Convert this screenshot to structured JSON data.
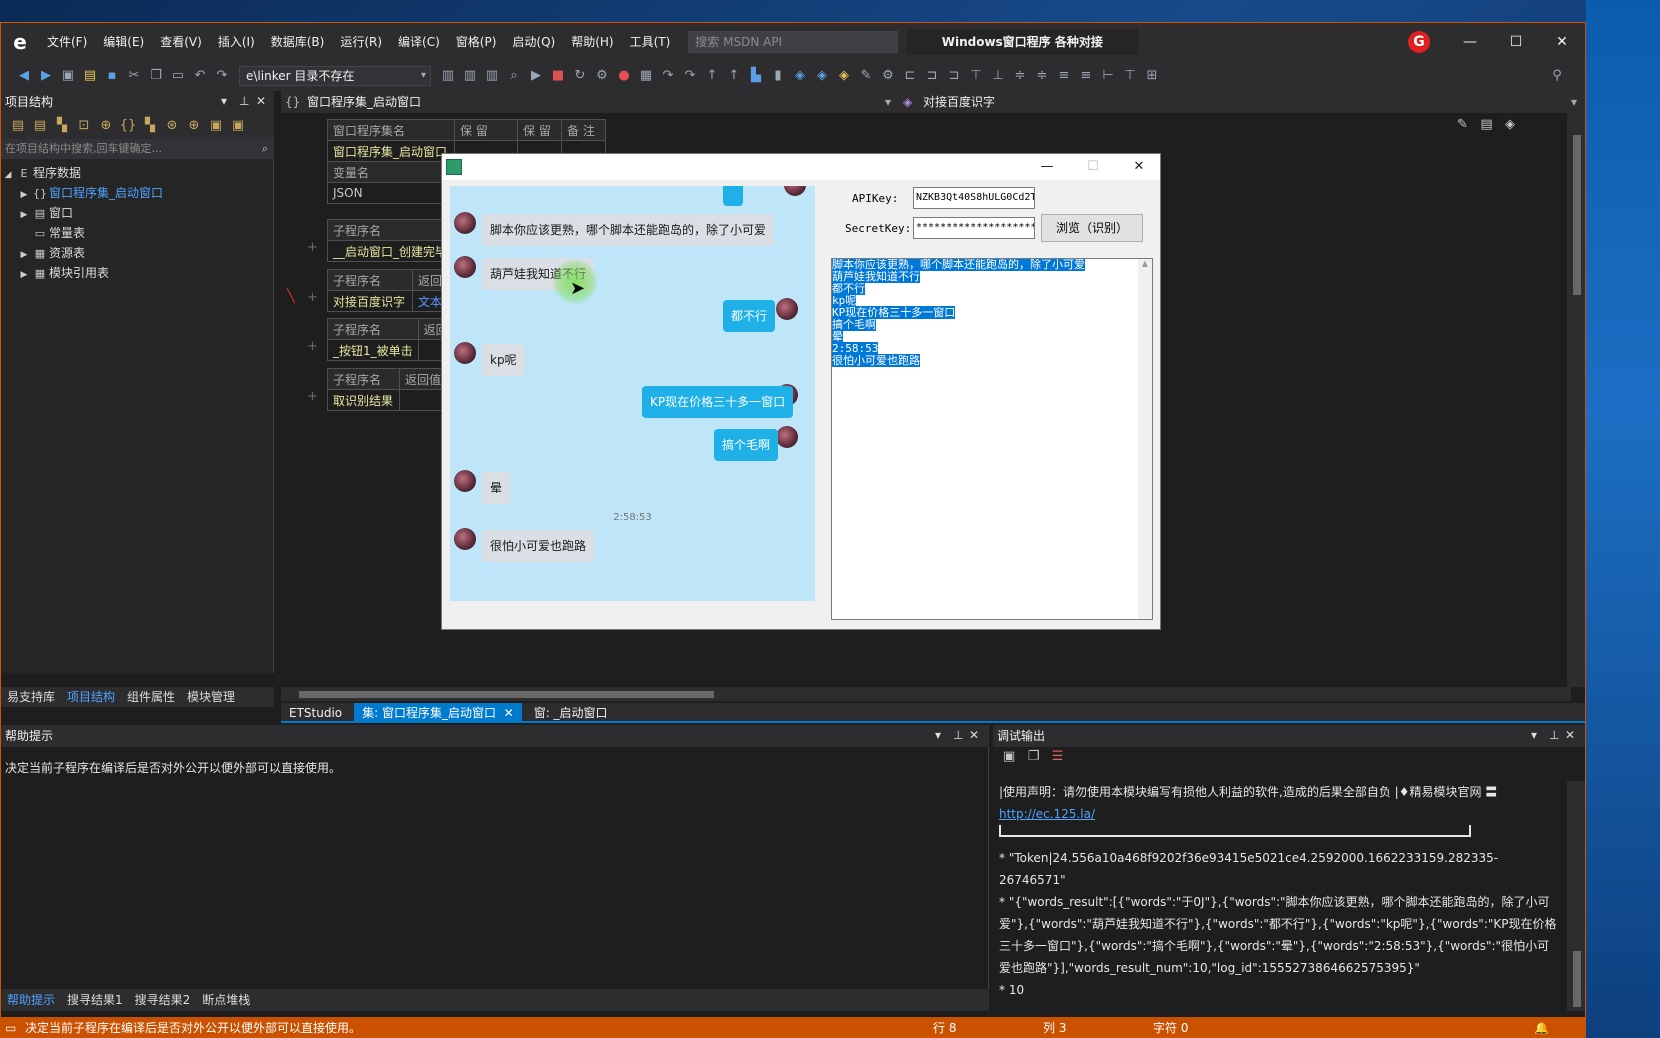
{
  "menu": {
    "items": [
      "文件(F)",
      "编辑(E)",
      "查看(V)",
      "插入(I)",
      "数据库(B)",
      "运行(R)",
      "编译(C)",
      "窗格(P)",
      "启动(Q)",
      "帮助(H)",
      "工具(T)"
    ],
    "search_placeholder": "搜索 MSDN API",
    "window_title": "Windows窗口程序  各种对接"
  },
  "toolbar": {
    "linker": "e\\linker 目录不存在"
  },
  "left_panel": {
    "title": "项目结构",
    "search_placeholder": "在项目结构中搜索,回车键确定...",
    "tree": [
      "程序数据",
      "窗口程序集_启动窗口",
      "窗口",
      "常量表",
      "资源表",
      "模块引用表"
    ],
    "bottom_tabs": [
      "易支持库",
      "项目结构",
      "组件属性",
      "模块管理"
    ]
  },
  "editor": {
    "selector_left": "窗口程序集_启动窗口",
    "selector_right": "对接百度识字",
    "table1": {
      "h1": "窗口程序集名",
      "h2": "保 留",
      "h3": "保 留",
      "h4": "备 注",
      "v1": "窗口程序集_启动窗口",
      "h5": "变量名",
      "v2": "JSON"
    },
    "table2": {
      "h1": "子程序名",
      "v1": "__启动窗口_创建完毕"
    },
    "table3": {
      "h1": "子程序名",
      "h2": "返回",
      "v1": "对接百度识字",
      "v2": "文本"
    },
    "table4": {
      "h1": "子程序名",
      "h2": "返回",
      "v1": "_按钮1_被单击"
    },
    "table5": {
      "h1": "子程序名",
      "h2": "返回值",
      "v1": "取识别结果"
    },
    "plus": "+"
  },
  "doc_tabs": [
    "ETStudio",
    "集: 窗口程序集_启动窗口",
    "窗: _启动窗口"
  ],
  "help_panel": {
    "title": "帮助提示",
    "text": "决定当前子程序在编译后是否对外公开以便外部可以直接使用。",
    "tabs": [
      "帮助提示",
      "搜寻结果1",
      "搜寻结果2",
      "断点堆栈"
    ]
  },
  "debug_panel": {
    "title": "调试输出",
    "line1": "|使用声明：请勿使用本模块编写有损他人利益的软件,造成的后果全部自负 |♦精易模块官网  〓",
    "link": "http://ec.125.la/",
    "line3": "*  \"Token|24.556a10a468f9202f36e93415e5021ce4.2592000.1662233159.282335-26746571\"",
    "line4": "*  \"{\"words_result\":[{\"words\":\"于0J\"},{\"words\":\"脚本你应该更熟，哪个脚本还能跑岛的，除了小可爱\"},{\"words\":\"葫芦娃我知道不行\"},{\"words\":\"都不行\"},{\"words\":\"kp呢\"},{\"words\":\"KP现在价格三十多一窗口\"},{\"words\":\"搞个毛啊\"},{\"words\":\"晕\"},{\"words\":\"2:58:53\"},{\"words\":\"很怕小可爱也跑路\"}],\"words_result_num\":10,\"log_id\":1555273864662575395}\"",
    "line5": "* 10"
  },
  "statusbar": {
    "text": "决定当前子程序在编译后是否对外公开以便外部可以直接使用。",
    "row": "行 8",
    "col": "列 3",
    "chars": "字符 0"
  },
  "app": {
    "chat": {
      "messages": [
        "脚本你应该更熟，哪个脚本还能跑岛的，除了小可爱",
        "葫芦娃我知道不行",
        "都不行",
        "kp呢",
        "KP现在价格三十多一窗口",
        "搞个毛啊",
        "晕",
        "很怕小可爱也跑路"
      ],
      "time": "2:58:53"
    },
    "apikey_label": "APIKey:",
    "apikey_value": "NZKB3Qt40S8hULG0Cd2T",
    "secret_label": "SecretKey:",
    "secret_value": "********************",
    "browse_label": "浏览（识别）",
    "result_lines": [
      "脚本你应该更熟，哪个脚本还能跑岛的，除了小可爱",
      "葫芦娃我知道不行",
      "都不行",
      "kp呢",
      "KP现在价格三十多一窗口",
      "搞个毛啊",
      "晕",
      "2:58:53",
      "很怕小可爱也跑路"
    ]
  }
}
